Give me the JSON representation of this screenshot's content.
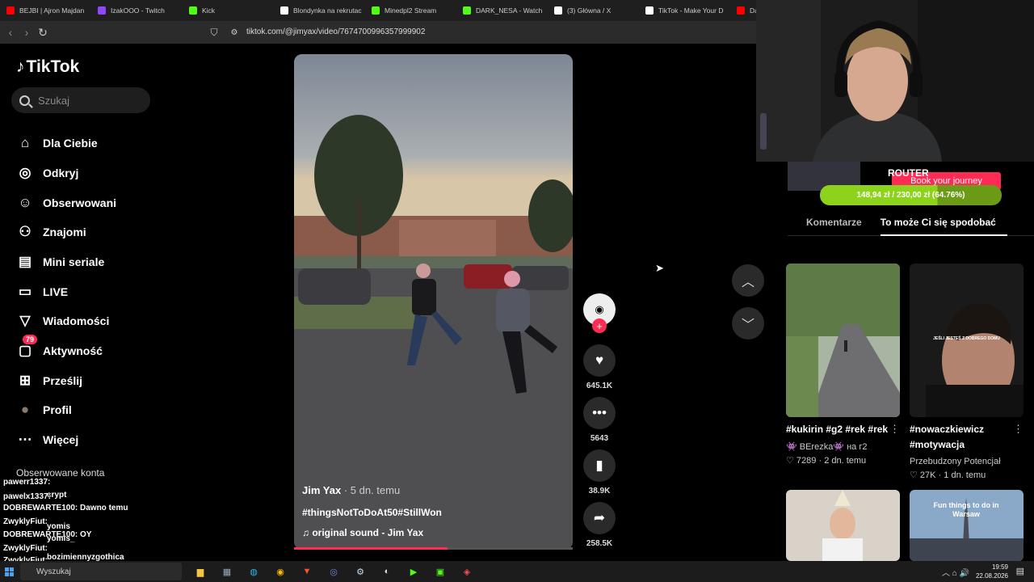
{
  "browser": {
    "tabs": [
      {
        "title": "BEJBI | Ajron Majdan",
        "icon": "youtube-icon",
        "color": "#ff0000"
      },
      {
        "title": "IzakOOO - Twitch",
        "icon": "twitch-icon",
        "color": "#9146ff"
      },
      {
        "title": "Kick",
        "icon": "kick-icon",
        "color": "#53fc18"
      },
      {
        "title": "Blondynka na rekrutac",
        "icon": "tiktok-icon",
        "color": "#ffffff"
      },
      {
        "title": "Minedpl2 Stream",
        "icon": "kick-icon",
        "color": "#53fc18"
      },
      {
        "title": "DARK_NESA - Watch",
        "icon": "kick-icon",
        "color": "#53fc18"
      },
      {
        "title": "(3) Główna / X",
        "icon": "x-icon",
        "color": "#ffffff"
      },
      {
        "title": "TikTok - Make Your D",
        "icon": "tiktok-icon",
        "color": "#ffffff"
      },
      {
        "title": "Daw",
        "icon": "youtube-icon",
        "color": "#ff0000"
      }
    ],
    "url": "tiktok.com/@jimyax/video/7674700996357999902"
  },
  "sidebar": {
    "logo": "TikTok",
    "search_placeholder": "Szukaj",
    "nav": [
      {
        "label": "Dla Ciebie",
        "icon": "home-icon"
      },
      {
        "label": "Odkryj",
        "icon": "compass-icon"
      },
      {
        "label": "Obserwowani",
        "icon": "following-icon"
      },
      {
        "label": "Znajomi",
        "icon": "friends-icon"
      },
      {
        "label": "Mini seriale",
        "icon": "film-icon"
      },
      {
        "label": "LIVE",
        "icon": "live-icon"
      },
      {
        "label": "Wiadomości",
        "icon": "send-icon"
      },
      {
        "label": "Aktywność",
        "icon": "inbox-icon",
        "badge": "79"
      },
      {
        "label": "Prześlij",
        "icon": "upload-icon"
      },
      {
        "label": "Profil",
        "icon": "avatar-icon"
      },
      {
        "label": "Więcej",
        "icon": "more-icon"
      }
    ],
    "followed_title": "Obserwowane konta"
  },
  "chat": [
    "pawerr1337:",
    "crypt",
    "pawelx1337:",
    "DOBREWARTE100: Dawno temu",
    "ZwyklyFiut:",
    "DOBREWARTE100: OY",
    "yomis",
    "yomis_",
    "ZwyklyFiut:",
    "ZwyklyFiut:",
    "bozimiennyzgothica",
    "ZwyklyFiut:"
  ],
  "video": {
    "author": "Jim Yax",
    "time": "· 5 dn. temu",
    "tags": "#thingsNotToDoAt50#StillWon",
    "sound": "original sound - Jim Yax",
    "progress": 0.55
  },
  "actions": {
    "likes": "645.1K",
    "comments": "5643",
    "saves": "38.9K",
    "shares": "258.5K"
  },
  "overlay": {
    "router": "ROUTER",
    "book": "Book your journey",
    "goal": "148,94 zł / 230,00 zł (64.76%)",
    "goal_fraction": 0.6476
  },
  "right_tabs": {
    "comments": "Komentarze",
    "suggested": "To może Ci się spodobać"
  },
  "cards": [
    {
      "title": "#kukirin #g2 #rek #rek",
      "author": "👾 BErezka👾 на г2",
      "likes": "7289",
      "time": "· 2 dn. temu"
    },
    {
      "title": "#nowaczkiewicz #motywacja",
      "author": "Przebudzony Potencjał",
      "likes": "27K",
      "time": "· 1 dn. temu"
    },
    {
      "title": "",
      "author": "",
      "likes": "",
      "time": "",
      "thumb_text": ""
    },
    {
      "title": "",
      "author": "",
      "likes": "",
      "time": "",
      "thumb_text": "Fun things to do in Warsaw"
    }
  ],
  "card2_overlay": "JEŚLI JESTEŚ Z DOBREGO DOMU",
  "taskbar": {
    "search": "Wyszukaj",
    "time": "19:59",
    "date": "22.08.2026"
  }
}
